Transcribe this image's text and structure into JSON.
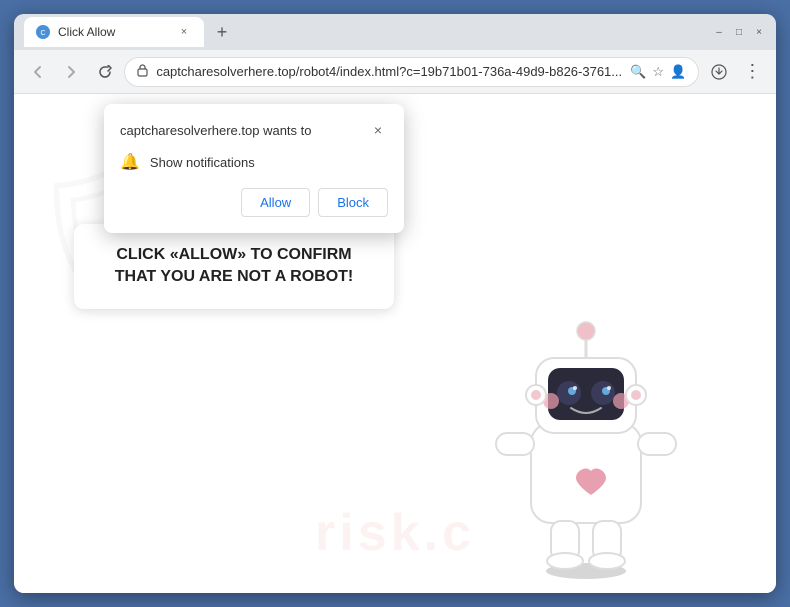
{
  "browser": {
    "title": "Click Allow",
    "tab": {
      "favicon": "🔵",
      "title": "Click Allow",
      "close_label": "×"
    },
    "new_tab_label": "+",
    "window_controls": {
      "minimize": "–",
      "maximize": "□",
      "close": "×"
    },
    "nav": {
      "back": "←",
      "forward": "→",
      "refresh": "↻",
      "url": "captcharesolverhere.top/robot4/index.html?c=19b71b01-736a-49d9-b826-3761...",
      "lock_icon": "🔒",
      "search_icon": "🔍",
      "bookmark_icon": "☆",
      "profile_icon": "👤",
      "menu_icon": "⋮",
      "download_icon": "⬇"
    }
  },
  "notification_popup": {
    "title": "captcharesolverhere.top wants to",
    "notification_item": "Show notifications",
    "close_label": "×",
    "allow_button": "Allow",
    "block_button": "Block"
  },
  "page": {
    "bubble_text": "CLICK «ALLOW» TO CONFIRM THAT YOU ARE NOT A ROBOT!",
    "watermark_text": "risk.c",
    "watermark_shield": "⚙"
  }
}
